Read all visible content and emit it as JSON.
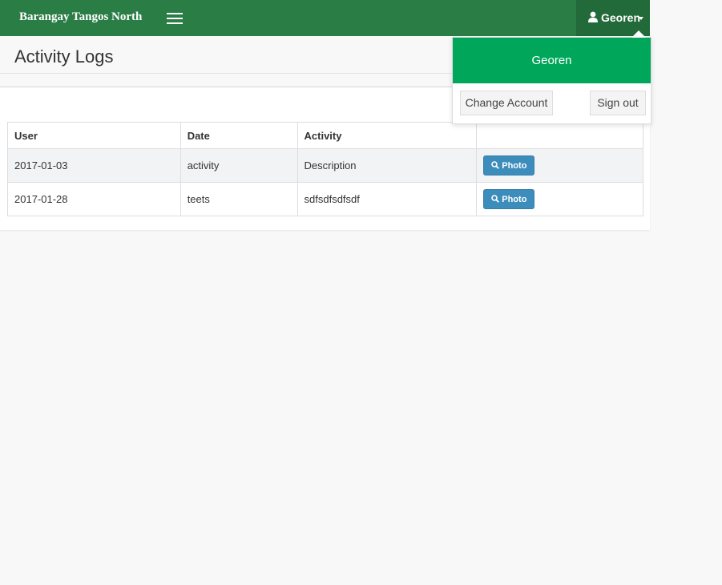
{
  "navbar": {
    "brand": "Barangay Tangos North",
    "user_name": "Georen"
  },
  "page": {
    "title": "Activity Logs"
  },
  "table": {
    "headers": [
      "User",
      "Date",
      "Activity",
      ""
    ],
    "rows": [
      {
        "user": "2017-01-03",
        "date": "activity",
        "activity": "Description",
        "action": "Photo"
      },
      {
        "user": "2017-01-28",
        "date": "teets",
        "activity": "sdfsdfsdfsdf",
        "action": "Photo"
      }
    ]
  },
  "user_menu": {
    "header_name": "Georen",
    "change_account": "Change Account",
    "sign_out": "Sign out"
  },
  "colors": {
    "navbar": "#2b7d46",
    "user_toggle": "#226a3a",
    "dropdown_header": "#00a65a",
    "photo_button": "#3c8dbc"
  },
  "icons": {
    "menu": "hamburger-icon",
    "user": "user-icon",
    "photo": "search-icon"
  }
}
